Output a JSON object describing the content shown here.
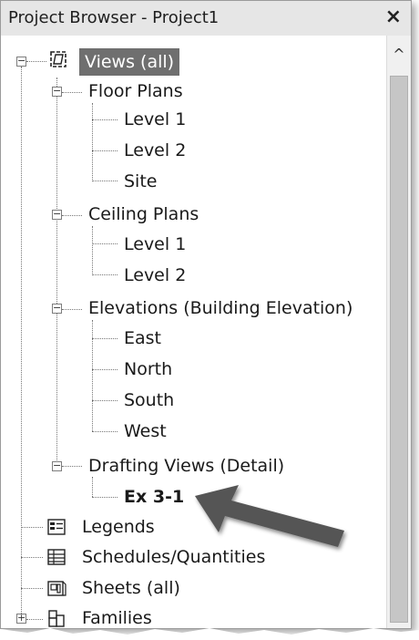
{
  "window": {
    "title": "Project Browser - Project1",
    "close_glyph": "×"
  },
  "scrollbar": {
    "up_glyph": "^"
  },
  "tree": {
    "root": {
      "label": "Views (all)",
      "icon": "views-icon",
      "expanded": true
    },
    "floor_plans": {
      "label": "Floor Plans",
      "children": [
        "Level 1",
        "Level 2",
        "Site"
      ]
    },
    "ceiling_plans": {
      "label": "Ceiling Plans",
      "children": [
        "Level 1",
        "Level 2"
      ]
    },
    "elevations": {
      "label": "Elevations (Building Elevation)",
      "children": [
        "East",
        "North",
        "South",
        "West"
      ]
    },
    "drafting_views": {
      "label": "Drafting Views (Detail)",
      "children": [
        "Ex 3-1"
      ]
    },
    "legends": {
      "label": "Legends",
      "icon": "legend-icon"
    },
    "schedules": {
      "label": "Schedules/Quantities",
      "icon": "schedule-icon"
    },
    "sheets": {
      "label": "Sheets (all)",
      "icon": "sheet-icon"
    },
    "families": {
      "label": "Families",
      "icon": "families-icon"
    }
  },
  "colors": {
    "selected_bg": "#6f6f6f",
    "titlebar_bg": "#e6e6e6",
    "scroll_thumb": "#c6c6c6",
    "annotation_arrow": "#555555"
  }
}
